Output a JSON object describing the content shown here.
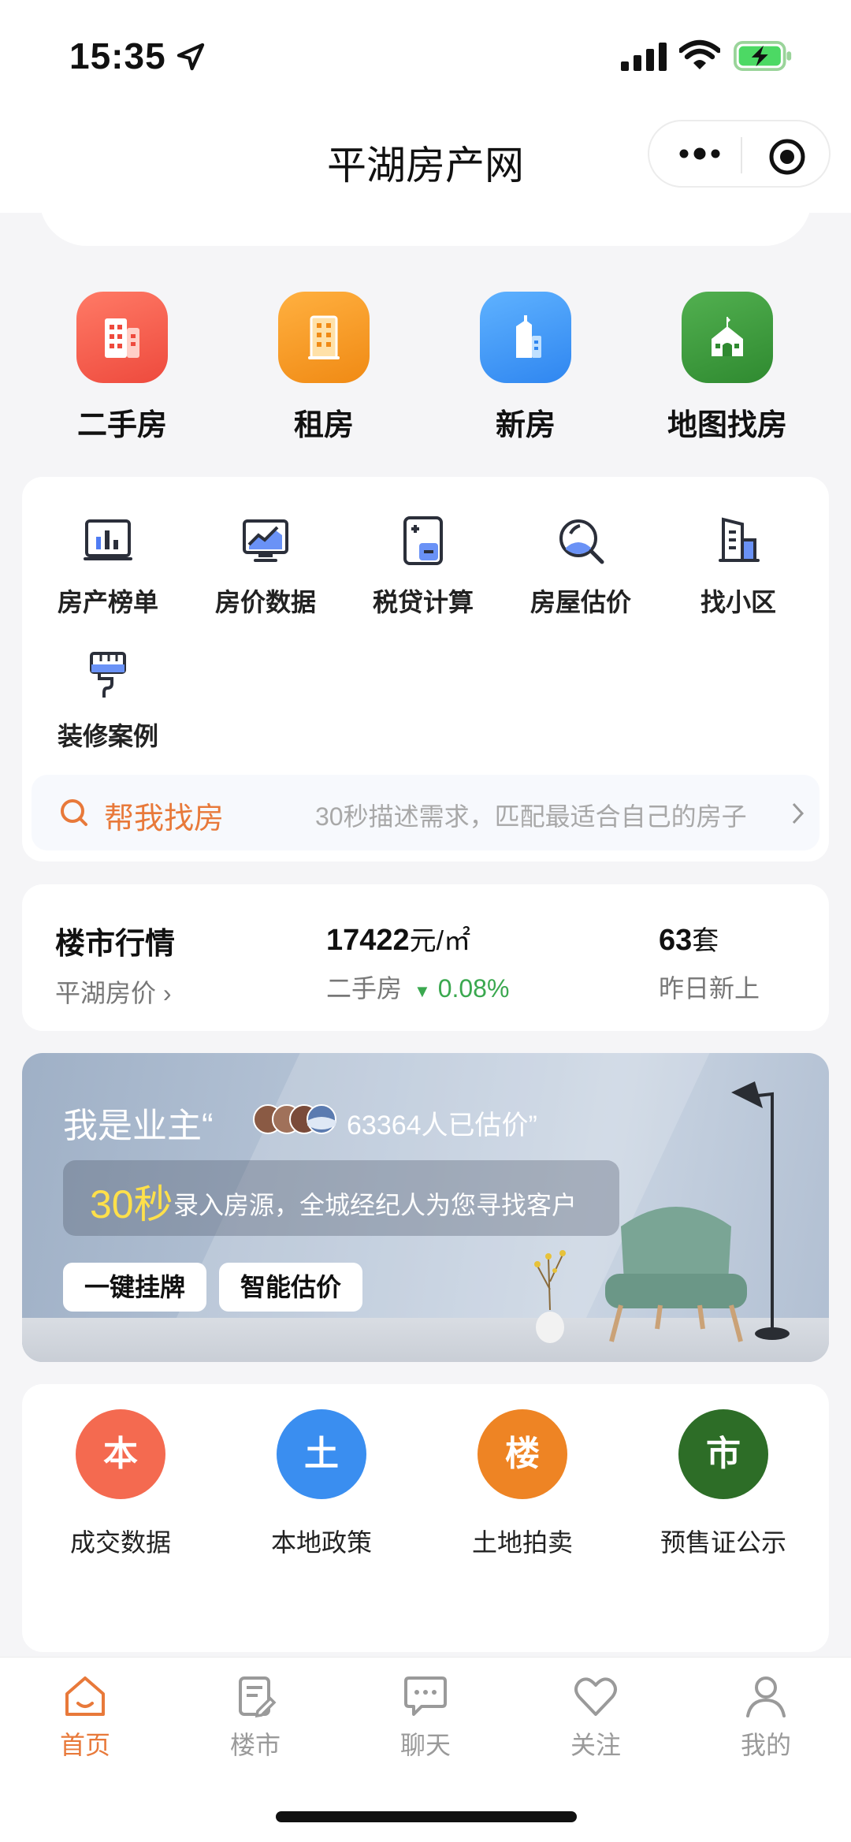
{
  "status_bar": {
    "time": "15:35",
    "icons": [
      "location-arrow-icon",
      "signal-icon",
      "wifi-icon",
      "battery-charging-icon"
    ]
  },
  "header": {
    "title": "平湖房产网",
    "capsule_icons": [
      "more-icon",
      "target-icon"
    ]
  },
  "main_categories": [
    {
      "label": "二手房",
      "icon": "building-icon",
      "color": "#f0574a"
    },
    {
      "label": "租房",
      "icon": "apartment-icon",
      "color": "#f3991e"
    },
    {
      "label": "新房",
      "icon": "new-building-icon",
      "color": "#3c93f5"
    },
    {
      "label": "地图找房",
      "icon": "map-house-icon",
      "color": "#3f9a3c"
    }
  ],
  "tools": [
    {
      "label": "房产榜单",
      "icon": "chart-board-icon"
    },
    {
      "label": "房价数据",
      "icon": "monitor-chart-icon"
    },
    {
      "label": "税贷计算",
      "icon": "calculator-icon"
    },
    {
      "label": "房屋估价",
      "icon": "magnifier-icon"
    },
    {
      "label": "找小区",
      "icon": "community-building-icon"
    },
    {
      "label": "装修案例",
      "icon": "paint-brush-icon"
    }
  ],
  "help_find": {
    "title": "帮我找房",
    "description": "30秒描述需求，匹配最适合自己的房子",
    "icon": "search-icon"
  },
  "market": {
    "title": "楼市行情",
    "subtitle": "平湖房价",
    "price_value": "17422",
    "price_unit": "元/㎡",
    "price_type": "二手房",
    "change": "0.08%",
    "change_direction": "down",
    "change_color": "#3aa84f",
    "new_count": "63",
    "new_unit": "套",
    "new_label": "昨日新上"
  },
  "banner": {
    "title": "我是业主",
    "quote_open": "“",
    "count_text": "63364人已估价”",
    "highlight": "30秒",
    "description": "录入房源，全城经纪人为您寻找客户",
    "buttons": [
      "一键挂牌",
      "智能估价"
    ],
    "highlight_color": "#ffe04a"
  },
  "data_categories": [
    {
      "char": "本",
      "label": "成交数据",
      "color": "#f46a50"
    },
    {
      "char": "土",
      "label": "本地政策",
      "color": "#3a8ef0"
    },
    {
      "char": "楼",
      "label": "土地拍卖",
      "color": "#ee8424"
    },
    {
      "char": "市",
      "label": "预售证公示",
      "color": "#2d6d27"
    }
  ],
  "tabbar": {
    "items": [
      {
        "label": "首页",
        "icon": "home-icon",
        "active": true
      },
      {
        "label": "楼市",
        "icon": "document-edit-icon",
        "active": false
      },
      {
        "label": "聊天",
        "icon": "chat-icon",
        "active": false
      },
      {
        "label": "关注",
        "icon": "heart-icon",
        "active": false
      },
      {
        "label": "我的",
        "icon": "user-icon",
        "active": false
      }
    ],
    "active_color": "#e8793a"
  }
}
